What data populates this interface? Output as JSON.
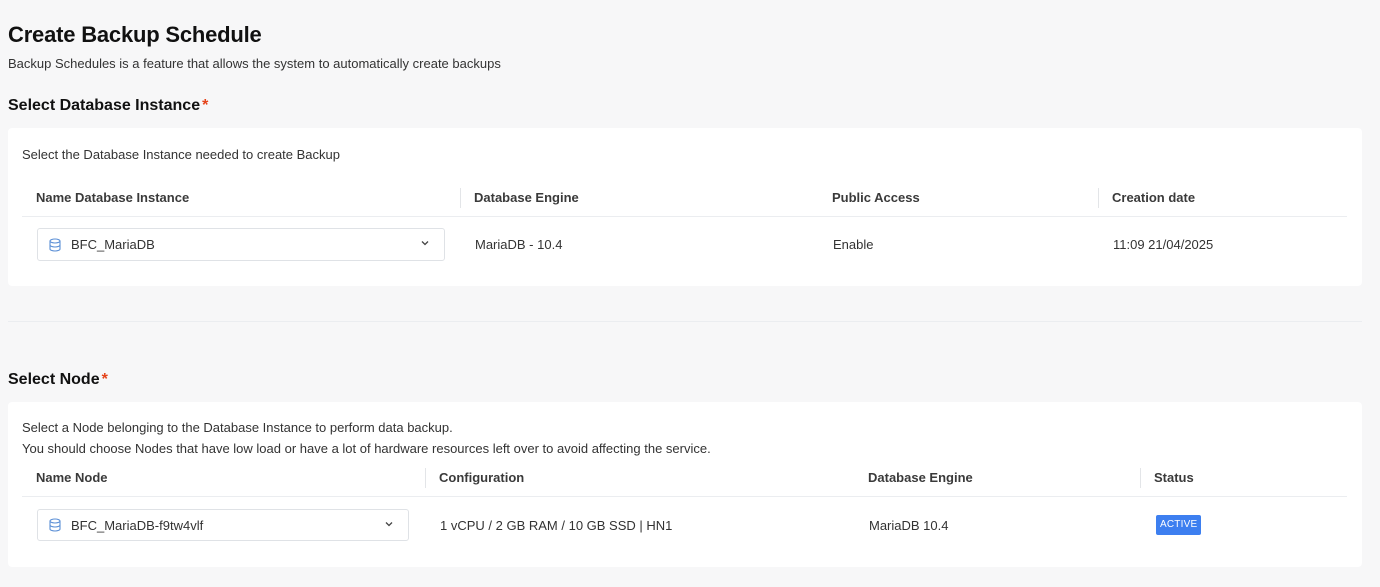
{
  "header": {
    "title": "Create Backup Schedule",
    "subtitle": "Backup Schedules is a feature that allows the system to automatically create backups"
  },
  "instance_section": {
    "title": "Select Database Instance",
    "required_mark": "*",
    "description": "Select the Database Instance needed to create Backup",
    "columns": [
      "Name Database Instance",
      "Database Engine",
      "Public Access",
      "Creation date"
    ],
    "row": {
      "instance_select": {
        "value": "BFC_MariaDB",
        "icon": "database-icon"
      },
      "engine": "MariaDB - 10.4",
      "public_access": "Enable",
      "creation_date": "11:09 21/04/2025"
    }
  },
  "node_section": {
    "title": "Select Node",
    "required_mark": "*",
    "description_line1": "Select a Node belonging to the Database Instance to perform data backup.",
    "description_line2": "You should choose Nodes that have low load or have a lot of hardware resources left over to avoid affecting the service.",
    "columns": [
      "Name Node",
      "Configuration",
      "Database Engine",
      "Status"
    ],
    "row": {
      "node_select": {
        "value": "BFC_MariaDB-f9tw4vlf",
        "icon": "database-icon"
      },
      "configuration": "1 vCPU / 2 GB RAM / 10 GB SSD | HN1",
      "engine": "MariaDB 10.4",
      "status": "ACTIVE"
    }
  },
  "colors": {
    "required": "#e5431a",
    "status_active": "#3d7ff0",
    "icon": "#5b8fd6"
  }
}
